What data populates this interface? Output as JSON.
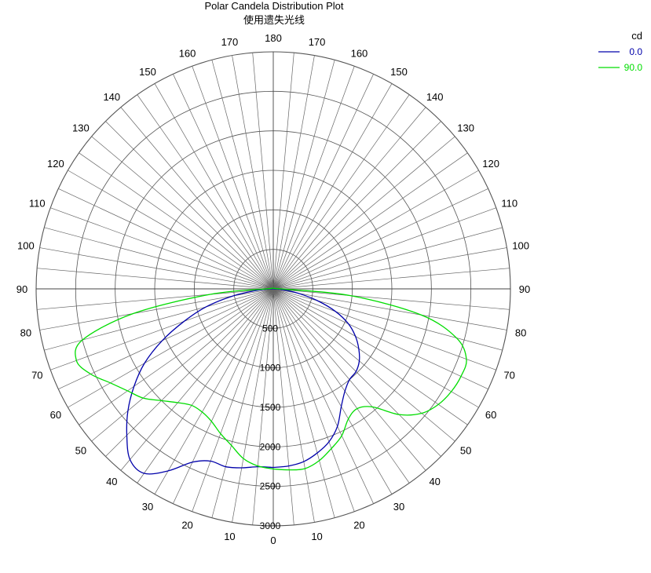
{
  "chart_data": {
    "type": "polar",
    "title": "Polar Candela Distribution Plot",
    "subtitle": "使用遗失光线",
    "unit_label": "cd",
    "grid": true,
    "legend_position": "top-right",
    "angle_ticks": [
      0,
      10,
      20,
      30,
      40,
      50,
      60,
      70,
      80,
      90,
      100,
      110,
      120,
      130,
      140,
      150,
      160,
      170,
      180
    ],
    "radial_ticks": [
      500,
      1000,
      1500,
      2000,
      2500,
      3000
    ],
    "radial_tick_labels": [
      "500",
      "1000",
      "1500",
      "2000",
      "2500",
      "3000"
    ],
    "radial_max": 3000,
    "series": [
      {
        "name": "0.0",
        "color": "#0000aa",
        "angles": [
          0,
          5,
          10,
          15,
          20,
          25,
          30,
          35,
          40,
          45,
          50,
          55,
          60,
          65,
          70,
          75,
          80,
          85,
          90
        ],
        "right": [
          2260,
          2250,
          2220,
          2150,
          2060,
          1920,
          1720,
          1580,
          1500,
          1480,
          1420,
          1320,
          1200,
          1050,
          840,
          580,
          320,
          120,
          20
        ],
        "left": [
          2260,
          2260,
          2300,
          2330,
          2320,
          2420,
          2660,
          2850,
          2820,
          2620,
          2400,
          2150,
          1880,
          1550,
          1200,
          880,
          520,
          200,
          20
        ]
      },
      {
        "name": "90.0",
        "color": "#00dd00",
        "angles": [
          0,
          5,
          10,
          15,
          20,
          25,
          30,
          35,
          40,
          45,
          50,
          55,
          60,
          65,
          70,
          75,
          80,
          85,
          90
        ],
        "right": [
          2280,
          2300,
          2310,
          2250,
          2150,
          2050,
          1900,
          1850,
          1950,
          2250,
          2450,
          2550,
          2600,
          2620,
          2600,
          2400,
          1900,
          980,
          80
        ],
        "left": [
          2280,
          2250,
          2180,
          2050,
          1950,
          1850,
          1800,
          1800,
          1880,
          2000,
          2150,
          2250,
          2380,
          2550,
          2650,
          2500,
          1800,
          800,
          80
        ]
      }
    ]
  }
}
